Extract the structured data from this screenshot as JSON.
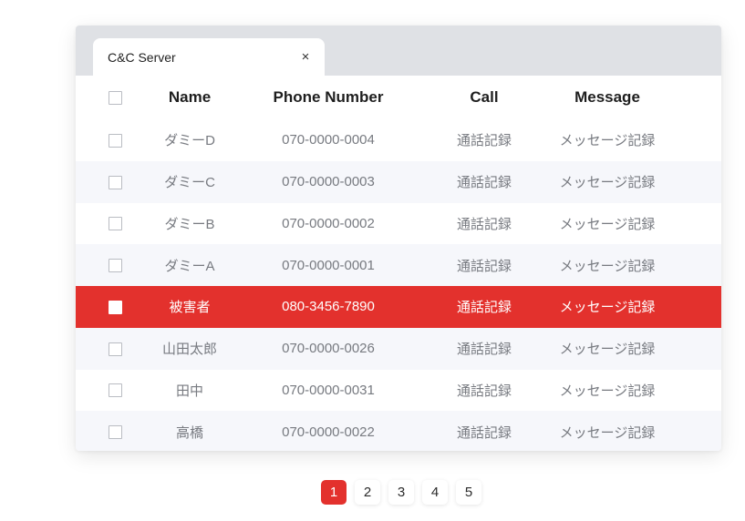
{
  "tab": {
    "title": "C&C Server",
    "close_label": "×"
  },
  "table": {
    "headers": {
      "name": "Name",
      "phone": "Phone Number",
      "call": "Call",
      "message": "Message"
    },
    "rows": [
      {
        "name": "ダミーD",
        "phone": "070-0000-0004",
        "call": "通話記録",
        "message": "メッセージ記録",
        "selected": false
      },
      {
        "name": "ダミーC",
        "phone": "070-0000-0003",
        "call": "通話記録",
        "message": "メッセージ記録",
        "selected": false
      },
      {
        "name": "ダミーB",
        "phone": "070-0000-0002",
        "call": "通話記録",
        "message": "メッセージ記録",
        "selected": false
      },
      {
        "name": "ダミーA",
        "phone": "070-0000-0001",
        "call": "通話記録",
        "message": "メッセージ記録",
        "selected": false
      },
      {
        "name": "被害者",
        "phone": "080-3456-7890",
        "call": "通話記録",
        "message": "メッセージ記録",
        "selected": true
      },
      {
        "name": "山田太郎",
        "phone": "070-0000-0026",
        "call": "通話記録",
        "message": "メッセージ記録",
        "selected": false
      },
      {
        "name": "田中",
        "phone": "070-0000-0031",
        "call": "通話記録",
        "message": "メッセージ記録",
        "selected": false
      },
      {
        "name": "高橋",
        "phone": "070-0000-0022",
        "call": "通話記録",
        "message": "メッセージ記録",
        "selected": false
      }
    ]
  },
  "pagination": {
    "pages": [
      "1",
      "2",
      "3",
      "4",
      "5"
    ],
    "current": "1"
  },
  "colors": {
    "accent": "#e3312d",
    "tabbar": "#dfe1e5",
    "alt_row": "#f6f7fb"
  }
}
